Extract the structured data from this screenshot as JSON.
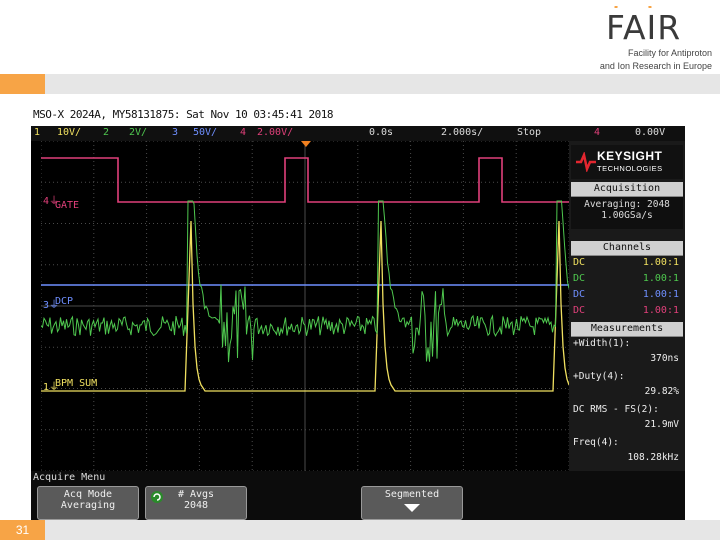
{
  "slide": {
    "logo_text": "FAIR",
    "tagline_line1": "Facility for Antiproton",
    "tagline_line2": "and Ion Research in Europe",
    "page_number": "31"
  },
  "scope": {
    "title": "MSO-X 2024A, MY58131875: Sat Nov 10 03:45:41 2018",
    "channel_bar": [
      {
        "text": "1",
        "color": "#f0e060"
      },
      {
        "text": "10V/",
        "color": "#f0e060"
      },
      {
        "text": "2",
        "color": "#4fc84f"
      },
      {
        "text": "2V/",
        "color": "#4fc84f"
      },
      {
        "text": "3",
        "color": "#6f8fff"
      },
      {
        "text": "50V/",
        "color": "#6f8fff"
      },
      {
        "text": "4",
        "color": "#e0407a"
      },
      {
        "text": "2.00V/",
        "color": "#e0407a"
      },
      {
        "text": "0.0s",
        "color": "#dddddd"
      },
      {
        "text": "2.000s/",
        "color": "#dddddd"
      },
      {
        "text": "Stop",
        "color": "#dddddd"
      },
      {
        "text": "4",
        "color": "#e0407a"
      },
      {
        "text": "0.00V",
        "color": "#dddddd"
      }
    ],
    "channel_labels": {
      "gate": "GATE",
      "dcp": "DCP",
      "bpm": "BPM SUM"
    },
    "colors": {
      "ch1": "#f0e060",
      "ch2": "#4fc84f",
      "ch3": "#6f8fff",
      "ch4": "#e0407a",
      "grid": "#4a4a4a"
    },
    "panel": {
      "brand_line1": "KEYSIGHT",
      "brand_line2": "TECHNOLOGIES",
      "acquisition_header": "Acquisition",
      "acq_mode": "Averaging: 2048",
      "acq_rate": "1.00GSa/s",
      "channels_header": "Channels",
      "channels": [
        {
          "coupling": "DC",
          "value": "1.00:1",
          "color": "#f0e060"
        },
        {
          "coupling": "DC",
          "value": "1.00:1",
          "color": "#4fc84f"
        },
        {
          "coupling": "DC",
          "value": "1.00:1",
          "color": "#6f8fff"
        },
        {
          "coupling": "DC",
          "value": "1.00:1",
          "color": "#e0407a"
        }
      ],
      "measurements_header": "Measurements",
      "measurements": [
        {
          "label": "+Width(1):",
          "value": "370ns"
        },
        {
          "label": "+Duty(4):",
          "value": "29.82%"
        },
        {
          "label": "DC RMS - FS(2):",
          "value": "21.9mV"
        },
        {
          "label": "Freq(4):",
          "value": "108.28kHz"
        }
      ]
    },
    "softkeys": {
      "menu_title": "Acquire Menu",
      "acq_mode_label": "Acq Mode",
      "acq_mode_value": "Averaging",
      "avgs_label": "# Avgs",
      "avgs_value": "2048",
      "segmented_label": "Segmented"
    }
  }
}
